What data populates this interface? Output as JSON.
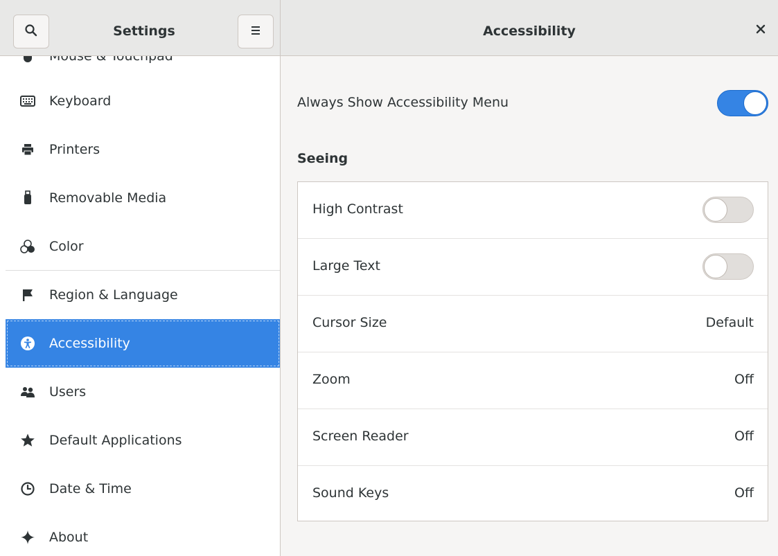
{
  "header": {
    "sidebar_title": "Settings",
    "panel_title": "Accessibility",
    "search_icon": "search-icon",
    "menu_icon": "hamburger-menu-icon",
    "close_icon": "close-icon"
  },
  "sidebar": {
    "partial_item": "Mouse & Touchpad",
    "items": [
      {
        "label": "Keyboard",
        "icon": "keyboard-icon"
      },
      {
        "label": "Printers",
        "icon": "printer-icon"
      },
      {
        "label": "Removable Media",
        "icon": "usb-icon"
      },
      {
        "label": "Color",
        "icon": "color-icon"
      },
      {
        "label": "Region & Language",
        "icon": "flag-icon"
      },
      {
        "label": "Accessibility",
        "icon": "accessibility-icon",
        "selected": true
      },
      {
        "label": "Users",
        "icon": "users-icon"
      },
      {
        "label": "Default Applications",
        "icon": "star-icon"
      },
      {
        "label": "Date & Time",
        "icon": "clock-icon"
      },
      {
        "label": "About",
        "icon": "sparkle-icon"
      }
    ]
  },
  "main": {
    "always_show_label": "Always Show Accessibility Menu",
    "always_show_on": true,
    "seeing_title": "Seeing",
    "rows": [
      {
        "label": "High Contrast",
        "type": "switch",
        "on": false
      },
      {
        "label": "Large Text",
        "type": "switch",
        "on": false
      },
      {
        "label": "Cursor Size",
        "type": "value",
        "value": "Default"
      },
      {
        "label": "Zoom",
        "type": "value",
        "value": "Off"
      },
      {
        "label": "Screen Reader",
        "type": "value",
        "value": "Off"
      },
      {
        "label": "Sound Keys",
        "type": "value",
        "value": "Off"
      }
    ]
  },
  "colors": {
    "accent": "#3584e4",
    "headerbar": "#e8e8e7",
    "panel_bg": "#f6f5f4"
  }
}
